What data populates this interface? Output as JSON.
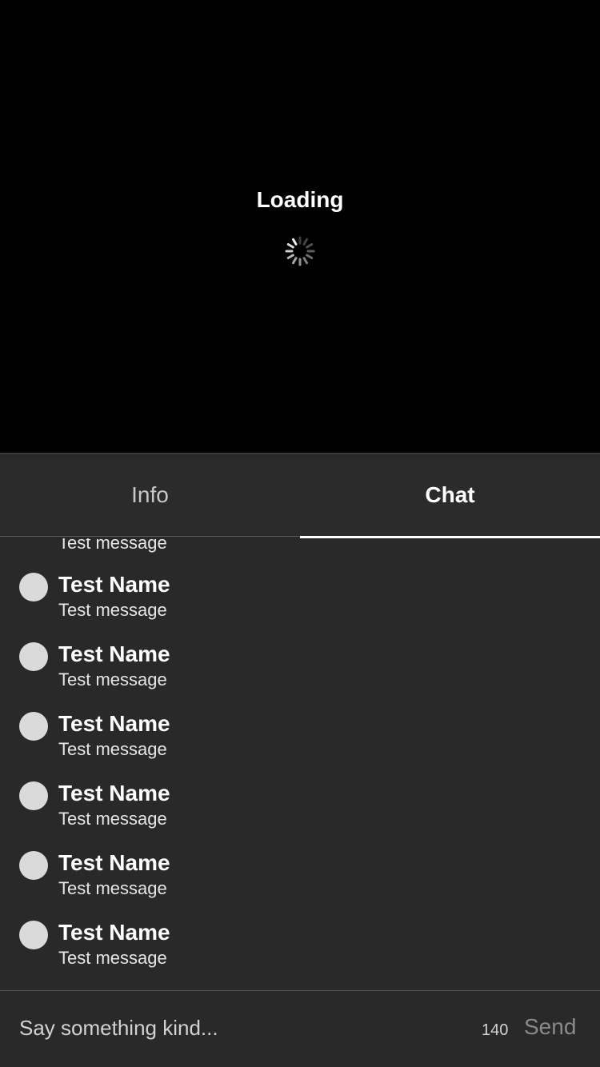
{
  "player": {
    "loading_text": "Loading",
    "spinner_icon": "activity-spinner-icon"
  },
  "tabs": [
    {
      "label": "Info",
      "selected": false
    },
    {
      "label": "Chat",
      "selected": true
    }
  ],
  "chat": {
    "partial_message": "Test message",
    "items": [
      {
        "name": "Test Name",
        "message": "Test message",
        "avatar_icon": "avatar-placeholder-icon"
      },
      {
        "name": "Test Name",
        "message": "Test message",
        "avatar_icon": "avatar-placeholder-icon"
      },
      {
        "name": "Test Name",
        "message": "Test message",
        "avatar_icon": "avatar-placeholder-icon"
      },
      {
        "name": "Test Name",
        "message": "Test message",
        "avatar_icon": "avatar-placeholder-icon"
      },
      {
        "name": "Test Name",
        "message": "Test message",
        "avatar_icon": "avatar-placeholder-icon"
      },
      {
        "name": "Test Name",
        "message": "Test message",
        "avatar_icon": "avatar-placeholder-icon"
      }
    ]
  },
  "composer": {
    "placeholder": "Say something kind...",
    "char_count": "140",
    "send_label": "Send"
  },
  "colors": {
    "panel_background": "#292929",
    "avatar_placeholder": "#dadada",
    "tab_indicator": "#ffffff",
    "send_disabled": "#8a8a8a"
  }
}
